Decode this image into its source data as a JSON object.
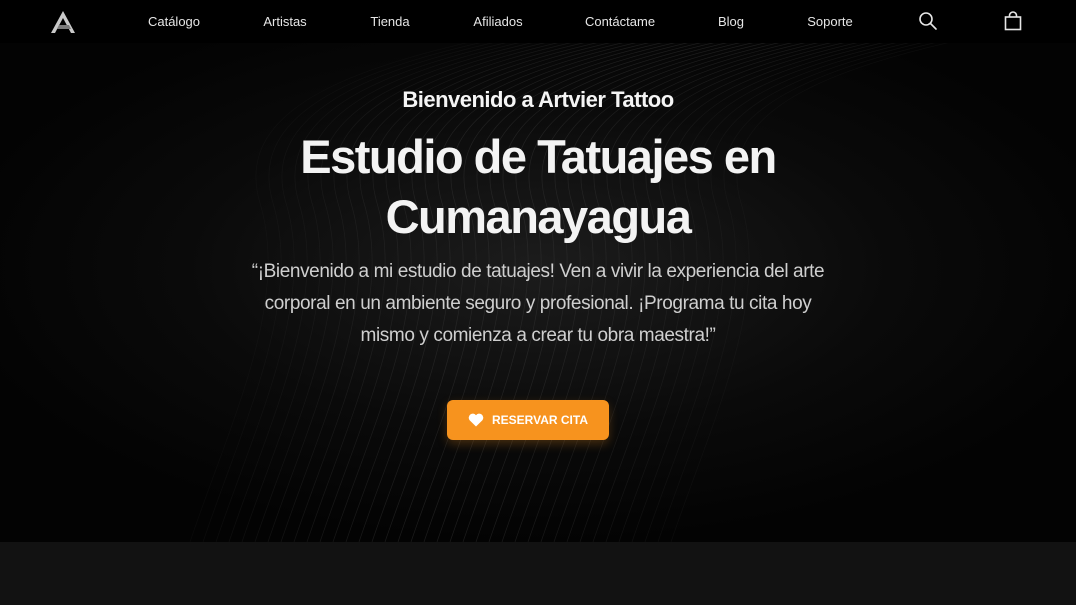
{
  "nav": {
    "logo_icon": "artvier-logo-icon",
    "links": [
      {
        "label": "Catálogo"
      },
      {
        "label": "Artistas"
      },
      {
        "label": "Tienda"
      },
      {
        "label": "Afiliados"
      },
      {
        "label": "Contáctame"
      },
      {
        "label": "Blog"
      },
      {
        "label": "Soporte"
      }
    ],
    "search_icon": "search-icon",
    "cart_icon": "shopping-bag-icon"
  },
  "hero": {
    "eyebrow": "Bienvenido a Artvier Tattoo",
    "headline": "Estudio de Tatuajes en Cumanayagua",
    "quote": "“¡Bienvenido a mi estudio de tatuajes! Ven a vivir la experiencia del arte corporal en un ambiente seguro y profesional. ¡Programa tu cita hoy mismo y comienza a crear tu obra maestra!”",
    "cta_label": "RESERVAR CITA",
    "cta_icon": "heart-icon"
  },
  "colors": {
    "accent": "#f7931e",
    "nav_background": "#000000",
    "hero_background": "#050505",
    "section_background": "#121212"
  }
}
